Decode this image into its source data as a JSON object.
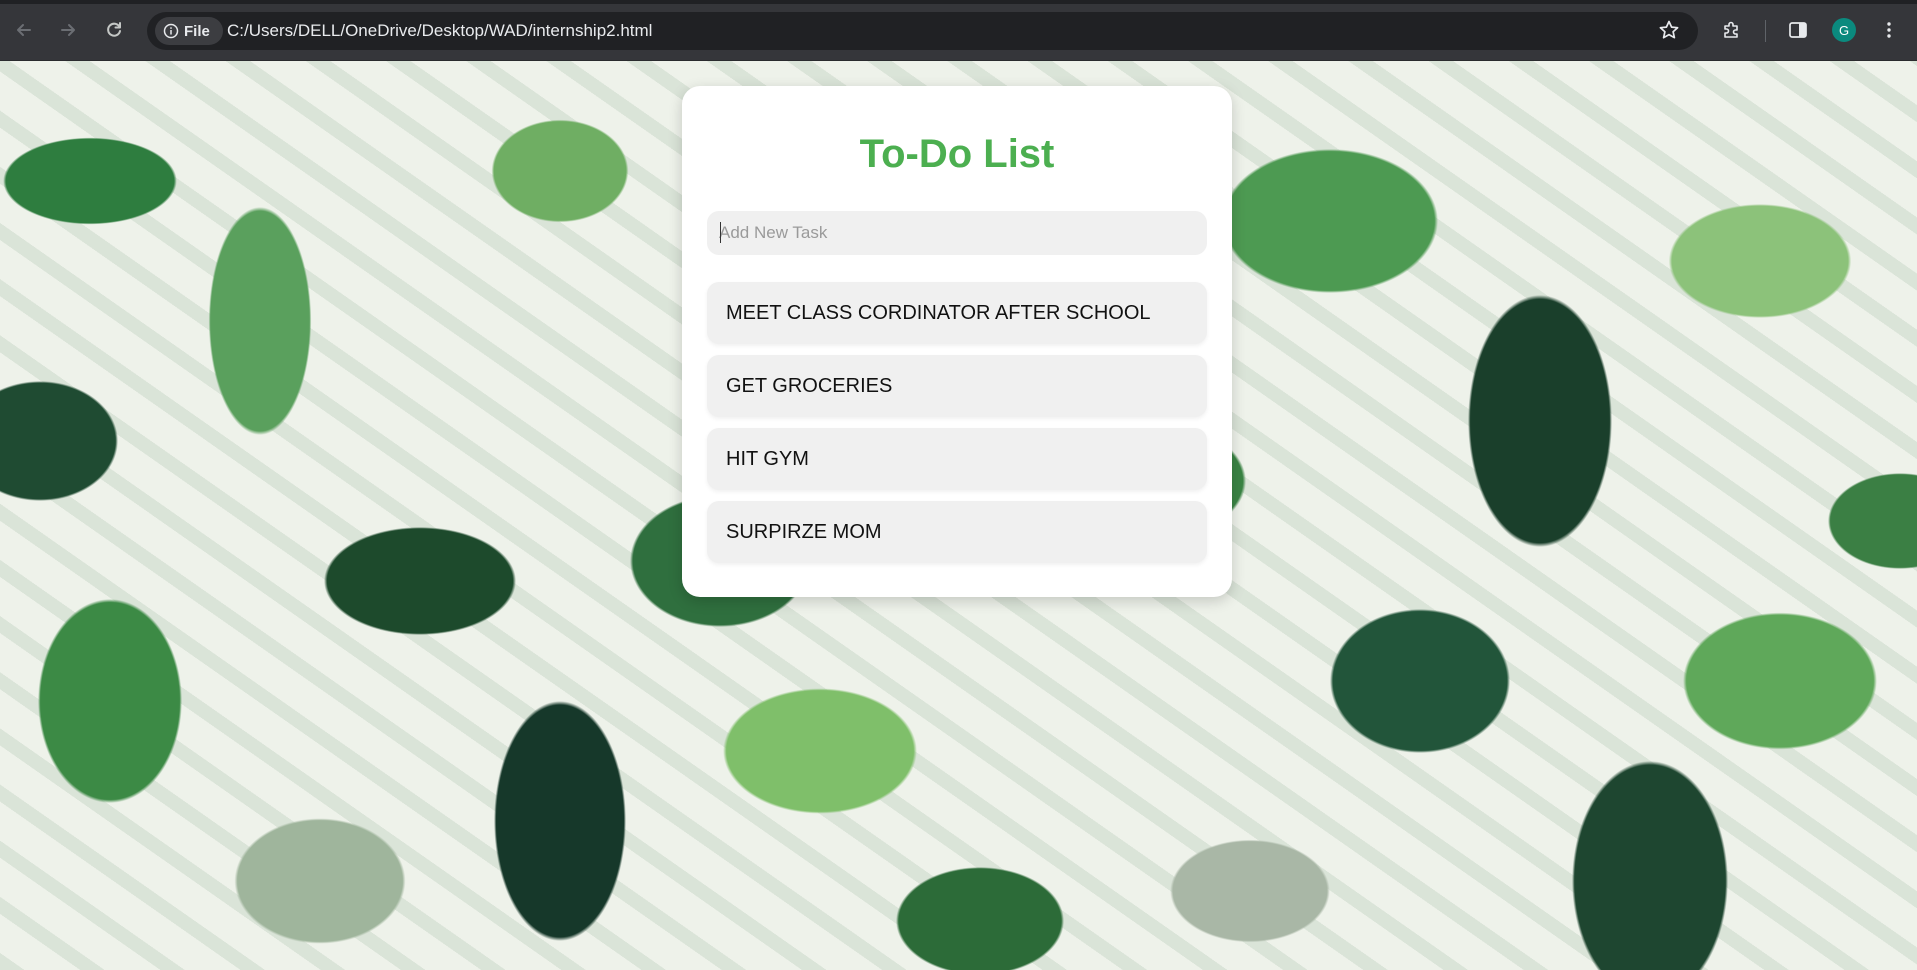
{
  "browser": {
    "site_chip_label": "File",
    "url": "C:/Users/DELL/OneDrive/Desktop/WAD/internship2.html",
    "profile_initial": "G",
    "icons": {
      "back": "back-arrow-icon",
      "forward": "forward-arrow-icon",
      "reload": "reload-icon",
      "site_info": "info-icon",
      "bookmark": "star-icon",
      "extensions": "puzzle-icon",
      "side_panel": "side-panel-icon",
      "menu": "kebab-menu-icon"
    }
  },
  "app": {
    "title": "To-Do List",
    "input_placeholder": "Add New Task",
    "input_value": "",
    "tasks": [
      {
        "label": "MEET CLASS CORDINATOR AFTER SCHOOL"
      },
      {
        "label": "GET GROCERIES"
      },
      {
        "label": "HIT GYM"
      },
      {
        "label": "SURPIRZE MOM"
      }
    ]
  },
  "colors": {
    "accent": "#4caf50",
    "chrome_bg": "#35363a",
    "omnibox_bg": "#202124",
    "task_bg": "#f0f0f0",
    "avatar_bg": "#0b8a7e"
  }
}
